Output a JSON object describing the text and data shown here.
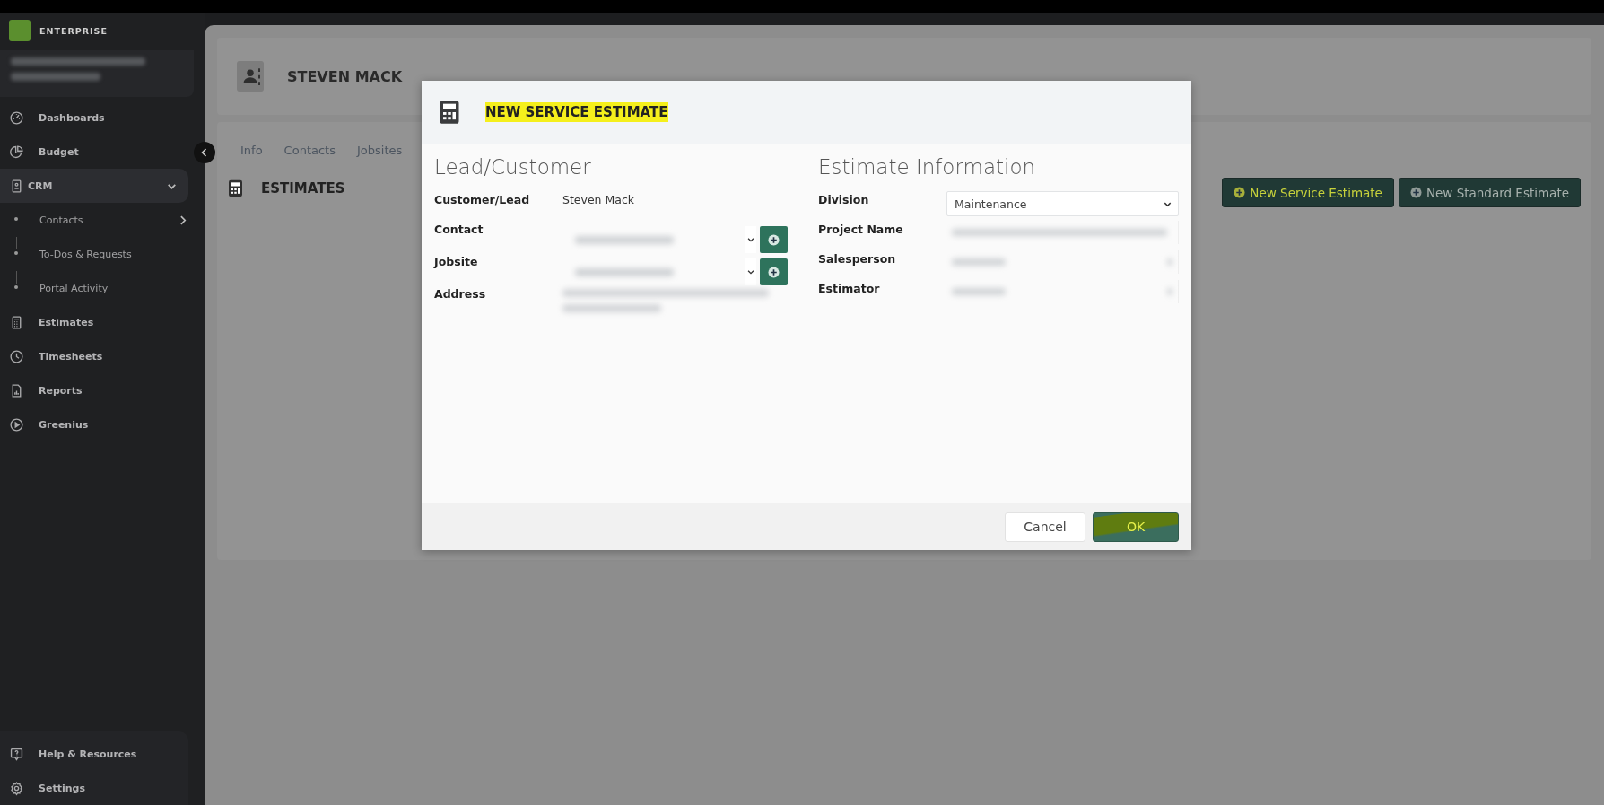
{
  "sidebar": {
    "brand": "ENTERPRISE",
    "items": [
      {
        "label": "Dashboards",
        "selected": false
      },
      {
        "label": "Budget",
        "selected": false
      },
      {
        "label": "CRM",
        "selected": true,
        "expanded": true,
        "children": [
          {
            "label": "Contacts",
            "has_submenu": true
          },
          {
            "label": "To-Dos & Requests",
            "has_submenu": false
          },
          {
            "label": "Portal Activity",
            "has_submenu": false
          }
        ]
      },
      {
        "label": "Estimates",
        "selected": false
      },
      {
        "label": "Timesheets",
        "selected": false
      },
      {
        "label": "Reports",
        "selected": false
      },
      {
        "label": "Greenius",
        "selected": false
      }
    ],
    "footer_items": [
      {
        "label": "Help & Resources"
      },
      {
        "label": "Settings"
      }
    ]
  },
  "header": {
    "title": "STEVEN MACK"
  },
  "tabs": [
    {
      "label": "Info"
    },
    {
      "label": "Contacts"
    },
    {
      "label": "Jobsites"
    }
  ],
  "estimates": {
    "title": "ESTIMATES",
    "buttons": [
      {
        "label": "New Service Estimate",
        "highlighted": true
      },
      {
        "label": "New Standard Estimate",
        "highlighted": false
      }
    ]
  },
  "modal": {
    "title": "NEW SERVICE ESTIMATE",
    "title_highlighted": true,
    "left": {
      "heading": "Lead/Customer",
      "fields": [
        {
          "label": "Customer/Lead",
          "kind": "text",
          "value": "Steven Mack"
        },
        {
          "label": "Contact",
          "kind": "select_add"
        },
        {
          "label": "Jobsite",
          "kind": "select_add"
        },
        {
          "label": "Address",
          "kind": "blurred"
        }
      ]
    },
    "right": {
      "heading": "Estimate Information",
      "fields": [
        {
          "label": "Division",
          "kind": "select",
          "value": "Maintenance"
        },
        {
          "label": "Project Name",
          "kind": "blurred_input"
        },
        {
          "label": "Salesperson",
          "kind": "blurred_select"
        },
        {
          "label": "Estimator",
          "kind": "blurred_select"
        }
      ]
    },
    "buttons": [
      {
        "label": "Cancel",
        "kind": "secondary",
        "highlighted": false
      },
      {
        "label": "OK",
        "kind": "primary",
        "highlighted": true
      }
    ]
  }
}
